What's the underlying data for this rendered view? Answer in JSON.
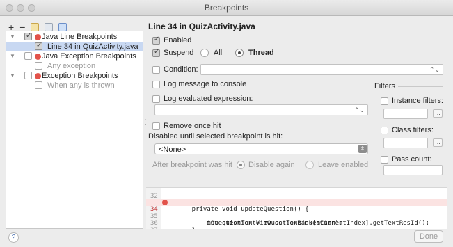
{
  "window": {
    "title": "Breakpoints"
  },
  "toolbar": {
    "add": "+",
    "remove": "−"
  },
  "tree": {
    "items": [
      {
        "label": "Java Line Breakpoints",
        "checked": true
      },
      {
        "label": "Line 34 in QuizActivity.java",
        "checked": true,
        "selected": true
      },
      {
        "label": "Java Exception Breakpoints",
        "checked": false
      },
      {
        "label": "Any exception",
        "checked": false
      },
      {
        "label": "Exception Breakpoints",
        "checked": false
      },
      {
        "label": "When any is thrown",
        "checked": false
      }
    ]
  },
  "detail": {
    "heading": "Line 34 in QuizActivity.java",
    "enabled_label": "Enabled",
    "suspend_label": "Suspend",
    "all_label": "All",
    "thread_label": "Thread",
    "condition_label": "Condition:",
    "condition_value": "",
    "log_message_label": "Log message to console",
    "log_expression_label": "Log evaluated expression:",
    "log_expression_value": "",
    "remove_label": "Remove once hit",
    "disabled_until_label": "Disabled until selected breakpoint is hit:",
    "disabled_until_value": "<None>",
    "after_hit_label": "After breakpoint was hit",
    "disable_again_label": "Disable again",
    "leave_enabled_label": "Leave enabled"
  },
  "filters": {
    "title": "Filters",
    "instance_label": "Instance filters:",
    "class_label": "Class filters:",
    "pass_label": "Pass count:",
    "browse_label": "..."
  },
  "code": {
    "lines": [
      {
        "n": "32",
        "text": ""
      },
      {
        "n": "33",
        "text": "    private void updateQuestion() {"
      },
      {
        "n": "34",
        "text": "        int question = mQuestionBank[mCurrentIndex].getTextResId();"
      },
      {
        "n": "35",
        "text": "        mQuestionTextView.setText(question);"
      },
      {
        "n": "36",
        "text": "    }"
      },
      {
        "n": "37",
        "text": ""
      }
    ]
  },
  "footer": {
    "help": "?",
    "done": "Done"
  }
}
